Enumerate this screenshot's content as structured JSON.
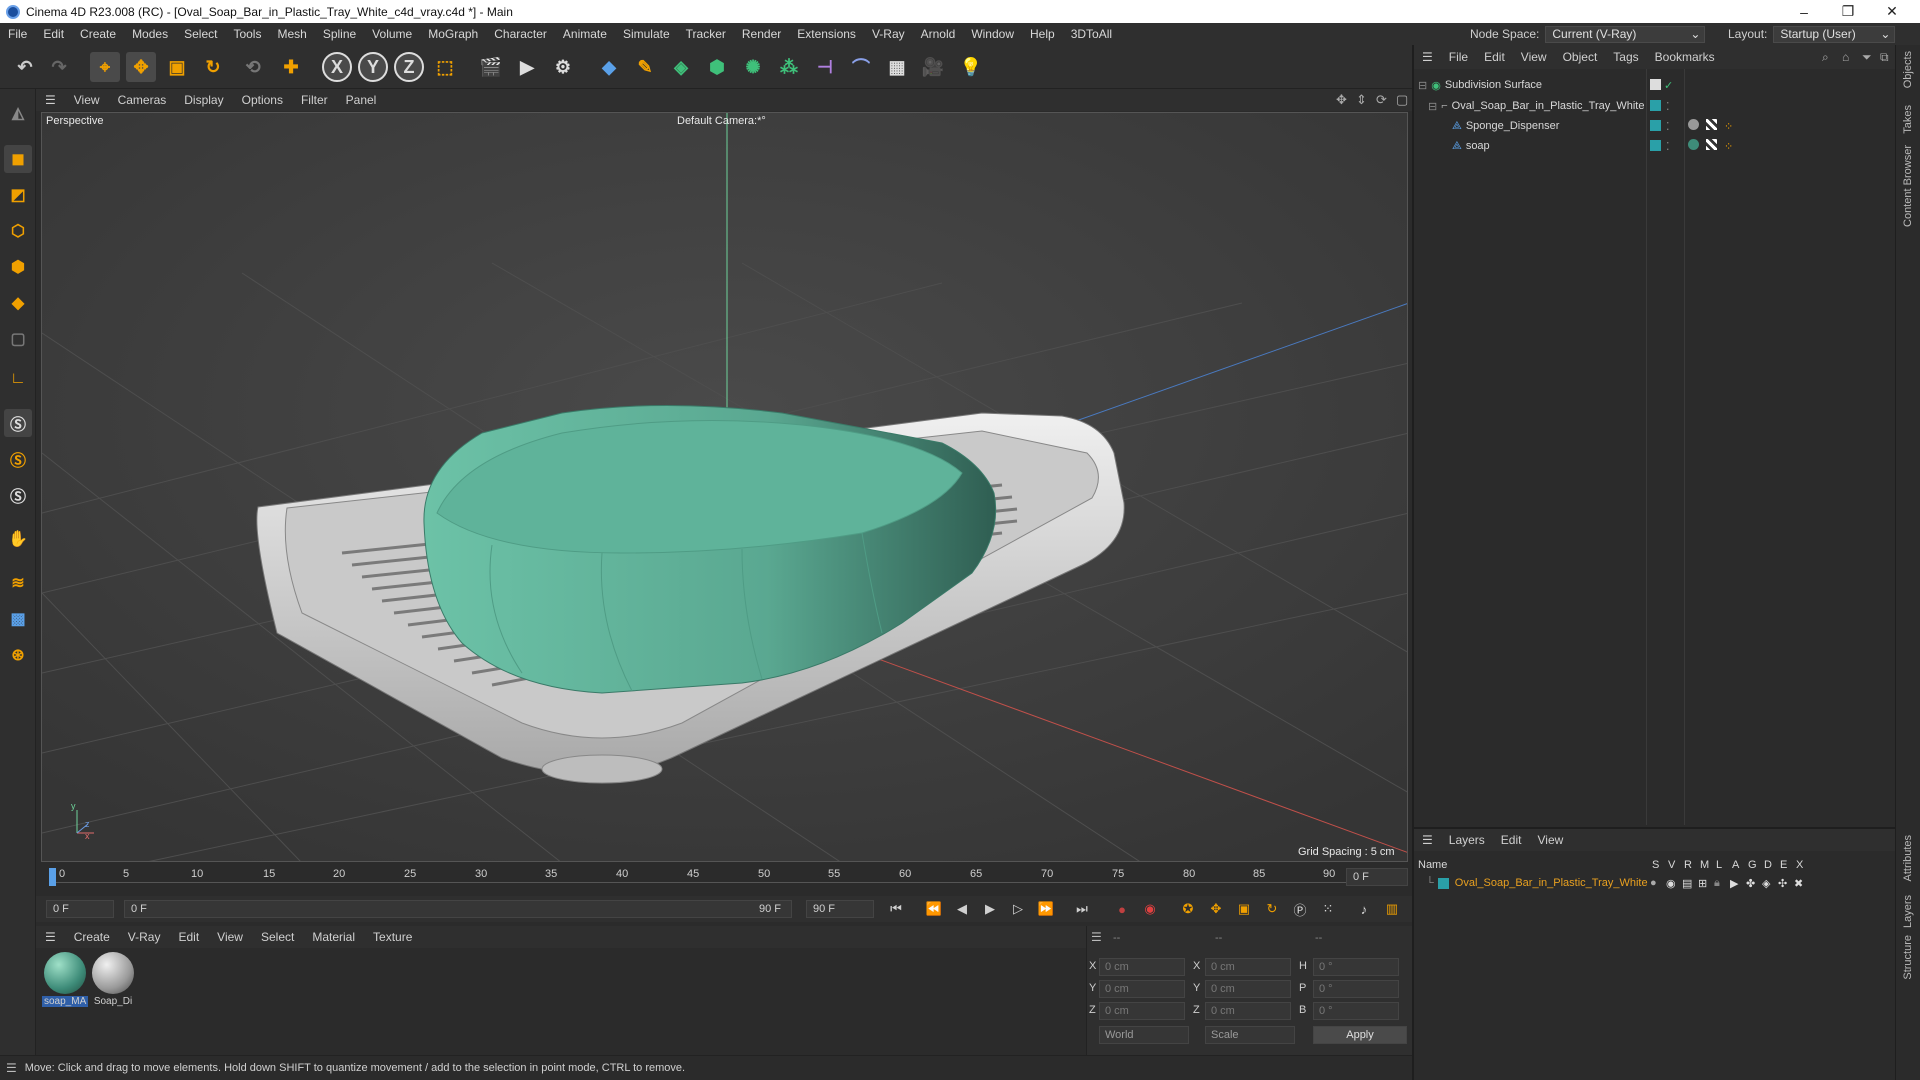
{
  "window": {
    "title": "Cinema 4D R23.008 (RC) - [Oval_Soap_Bar_in_Plastic_Tray_White_c4d_vray.c4d *] - Main",
    "minimize": "–",
    "maximize": "❐",
    "close": "✕"
  },
  "menu": [
    "File",
    "Edit",
    "Create",
    "Modes",
    "Select",
    "Tools",
    "Mesh",
    "Spline",
    "Volume",
    "MoGraph",
    "Character",
    "Animate",
    "Simulate",
    "Tracker",
    "Render",
    "Extensions",
    "V-Ray",
    "Arnold",
    "Window",
    "Help",
    "3DToAll"
  ],
  "node_space": {
    "label": "Node Space:",
    "value": "Current (V-Ray)"
  },
  "layout": {
    "label": "Layout:",
    "value": "Startup (User)"
  },
  "viewport_menu": [
    "View",
    "Cameras",
    "Display",
    "Options",
    "Filter",
    "Panel"
  ],
  "viewport": {
    "name": "Perspective",
    "camera": "Default Camera:*°",
    "grid_spacing": "Grid Spacing : 5 cm",
    "axis_x": "x",
    "axis_y": "y",
    "axis_z": "z"
  },
  "timeline": {
    "ticks": [
      "0",
      "5",
      "10",
      "15",
      "20",
      "25",
      "30",
      "35",
      "40",
      "45",
      "50",
      "55",
      "60",
      "65",
      "70",
      "75",
      "80",
      "85",
      "90"
    ],
    "current_frame": "0 F"
  },
  "transport": {
    "start": "0 F",
    "range_start": "0 F",
    "range_end": "90 F",
    "end": "90 F"
  },
  "material_menu": [
    "Create",
    "V-Ray",
    "Edit",
    "View",
    "Select",
    "Material",
    "Texture"
  ],
  "materials": [
    {
      "name": "soap_MA",
      "color": "#3e8c79"
    },
    {
      "name": "Soap_Di",
      "color": "#9a9a9a"
    }
  ],
  "coords": {
    "headers": [
      "--",
      "--",
      "--"
    ],
    "rows": [
      {
        "a": "X",
        "v1": "0 cm",
        "b": "X",
        "v2": "0 cm",
        "c": "H",
        "v3": "0 °"
      },
      {
        "a": "Y",
        "v1": "0 cm",
        "b": "Y",
        "v2": "0 cm",
        "c": "P",
        "v3": "0 °"
      },
      {
        "a": "Z",
        "v1": "0 cm",
        "b": "Z",
        "v2": "0 cm",
        "c": "B",
        "v3": "0 °"
      }
    ],
    "space": "World",
    "mode": "Scale",
    "apply": "Apply"
  },
  "status": "Move: Click and drag to move elements. Hold down SHIFT to quantize movement / add to the selection in point mode, CTRL to remove.",
  "object_menu": [
    "File",
    "Edit",
    "View",
    "Object",
    "Tags",
    "Bookmarks"
  ],
  "objects": [
    {
      "name": "Subdivision Surface",
      "indent": 0
    },
    {
      "name": "Oval_Soap_Bar_in_Plastic_Tray_White",
      "indent": 1
    },
    {
      "name": "Sponge_Dispenser",
      "indent": 2
    },
    {
      "name": "soap",
      "indent": 2
    }
  ],
  "layers_menu": [
    "Layers",
    "Edit",
    "View"
  ],
  "layers_header": {
    "name": "Name",
    "flags": [
      "S",
      "V",
      "R",
      "M",
      "L",
      "A",
      "G",
      "D",
      "E",
      "X"
    ]
  },
  "layers": [
    {
      "name": "Oval_Soap_Bar_in_Plastic_Tray_White",
      "color": "#2aa0a8"
    }
  ],
  "side_tabs": [
    "Objects",
    "Takes",
    "Content Browser",
    "Attributes",
    "Layers",
    "Structure"
  ],
  "colors": {
    "accent": "#f0a000",
    "layer_text": "#e8a020",
    "soap": "#5fb39a",
    "tray": "#d8d8d8"
  }
}
